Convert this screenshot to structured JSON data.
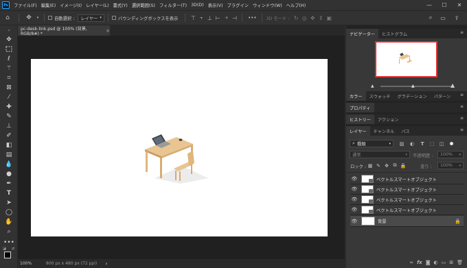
{
  "app": {
    "logo": "Ps"
  },
  "menu": [
    "ファイル(F)",
    "編集(E)",
    "イメージ(I)",
    "レイヤー(L)",
    "書式(Y)",
    "選択範囲(S)",
    "フィルター(T)",
    "3D(D)",
    "表示(V)",
    "プラグイン",
    "ウィンドウ(W)",
    "ヘルプ(H)"
  ],
  "window_controls": {
    "minimize": "—",
    "maximize": "☐",
    "close": "✕"
  },
  "options": {
    "auto_select_label": "自動選択 :",
    "auto_select_value": "レイヤー",
    "bounding_box_label": "バウンディングボックスを表示",
    "more": "•••",
    "mode3d_label": "3D モード :"
  },
  "document": {
    "tab_title": "pc-desk-link.psd @ 100% (背景, RGB/8#) *",
    "close": "×"
  },
  "status": {
    "zoom": "100%",
    "doc_size": "800 px x 480 px (72 ppi)",
    "arrow": "›"
  },
  "panels": {
    "group1_tabs": [
      "ナビゲーター",
      "ヒストグラム"
    ],
    "group2_tabs": [
      "カラー",
      "スウォッチ",
      "グラデーション",
      "パターン"
    ],
    "group3_tabs": [
      "プロパティ"
    ],
    "group4_tabs": [
      "ヒストリー",
      "アクション"
    ],
    "group5_tabs": [
      "レイヤー",
      "チャンネル",
      "パス"
    ],
    "menu_icon": "≡"
  },
  "layers_panel": {
    "filter_kind": "種類",
    "blend_mode": "通常",
    "opacity_label": "不透明度 :",
    "opacity_value": "100%",
    "lock_label": "ロック :",
    "fill_label": "塗り :",
    "fill_value": "100%",
    "layers": [
      {
        "name": "ベクトルスマートオブジェクト"
      },
      {
        "name": "ベクトルスマートオブジェクト"
      },
      {
        "name": "ベクトルスマートオブジェクト"
      },
      {
        "name": "ベクトルスマートオブジェクト"
      },
      {
        "name": "背景"
      }
    ]
  },
  "colors": {
    "accent": "#31a8ff",
    "nav_frame": "#e03030",
    "canvas_bg": "#202020",
    "fg_color": "#000000",
    "bg_color": "#1a50ff"
  }
}
